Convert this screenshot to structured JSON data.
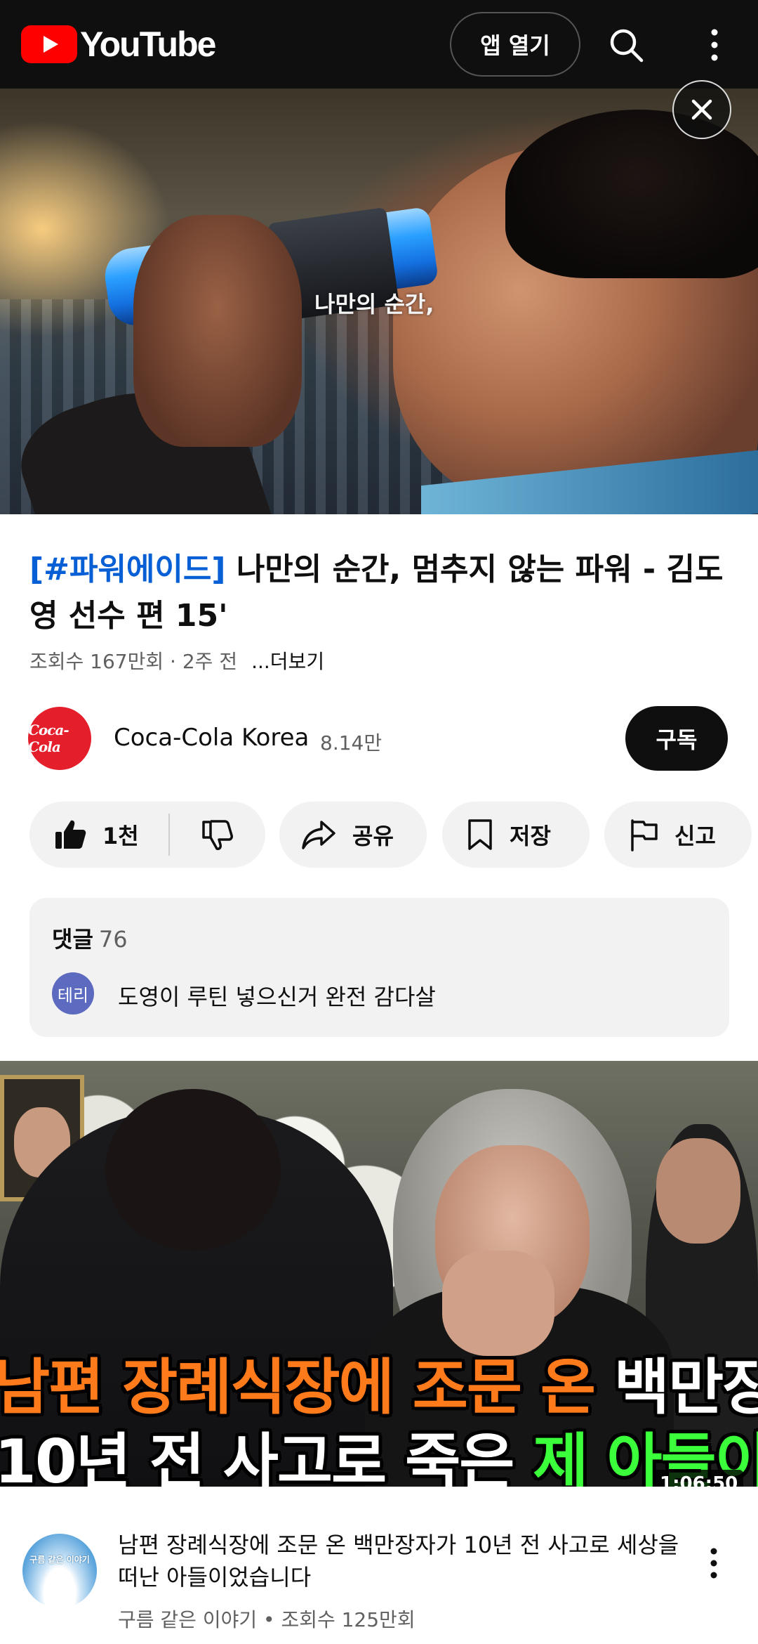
{
  "topbar": {
    "logo_text": "YouTube",
    "open_app_label": "앱 열기",
    "search_icon": "search-icon",
    "more_icon": "more-vert-icon"
  },
  "ad": {
    "subtitle": "나만의 순간,",
    "close_icon": "close-icon"
  },
  "video": {
    "title_tag": "[#파워에이드]",
    "title_rest": " 나만의 순간, 멈추지 않는 파워 - 김도영 선수 편 15'",
    "meta": "조회수 167만회 · 2주 전",
    "more_label": "...더보기"
  },
  "channel": {
    "avatar_text": "Coca-Cola",
    "name": "Coca-Cola Korea",
    "subscribers": "8.14만",
    "subscribe_label": "구독"
  },
  "actions": {
    "like_count": "1천",
    "share_label": "공유",
    "save_label": "저장",
    "report_label": "신고"
  },
  "comments": {
    "header": "댓글",
    "count": "76",
    "avatar_text": "테리",
    "top_comment": "도영이 루틴 넣으신거 완전 감다살"
  },
  "next_video": {
    "caption_line1_a": "남편 장례식장에 조문 온 ",
    "caption_line1_b": "백만장자가",
    "caption_line2_a": "10년 전 사고로 죽은 ",
    "caption_line2_b": "제 아들이었습니다..",
    "duration": "1:06:50",
    "channel_avatar_text": "구름 같은 이야기",
    "title": "남편 장례식장에 조문 온 백만장자가 10년 전 사고로 세상을 떠난 아들이었습니다",
    "meta": "구름 같은 이야기 • 조회수 125만회"
  },
  "colors": {
    "brand_red": "#ff0000",
    "link_blue": "#065fd4",
    "caption_orange": "#ff7a1a",
    "caption_green": "#3cff3c"
  }
}
